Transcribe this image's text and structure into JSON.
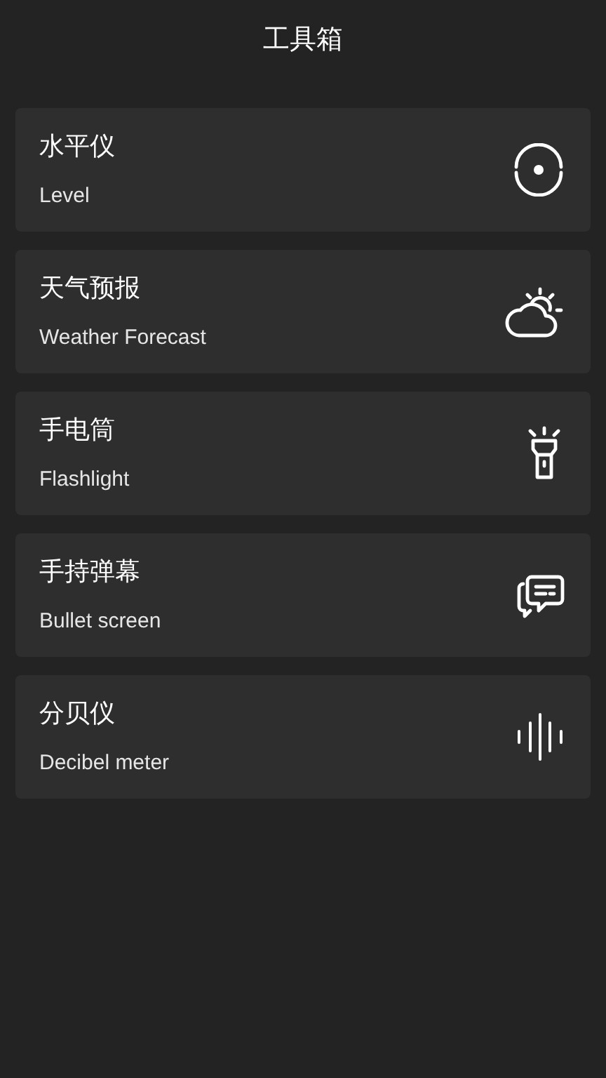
{
  "title": "工具箱",
  "tools": [
    {
      "name": "水平仪",
      "subtitle": "Level",
      "kind": "level"
    },
    {
      "name": "天气预报",
      "subtitle": "Weather Forecast",
      "kind": "weather"
    },
    {
      "name": "手电筒",
      "subtitle": "Flashlight",
      "kind": "flashlight"
    },
    {
      "name": "手持弹幕",
      "subtitle": "Bullet screen",
      "kind": "bullet"
    },
    {
      "name": "分贝仪",
      "subtitle": "Decibel meter",
      "kind": "decibel"
    }
  ]
}
